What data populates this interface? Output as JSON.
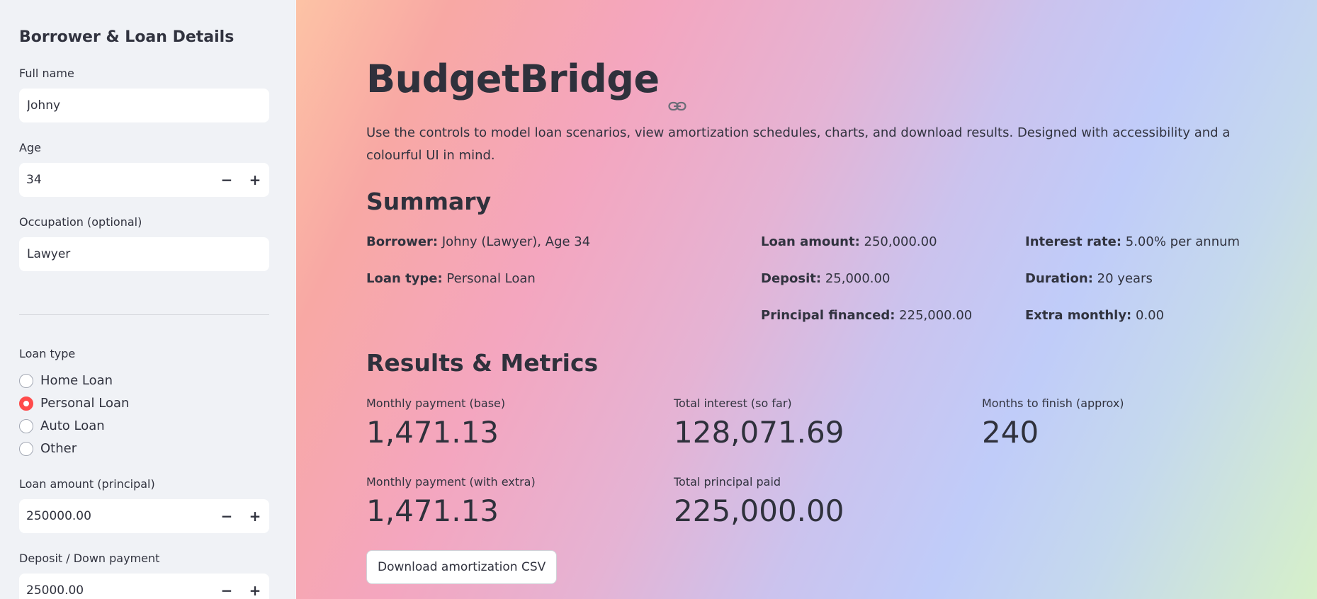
{
  "sidebar": {
    "title": "Borrower & Loan Details",
    "full_name": {
      "label": "Full name",
      "value": "Johny"
    },
    "age": {
      "label": "Age",
      "value": "34",
      "minus": "−",
      "plus": "+"
    },
    "occupation": {
      "label": "Occupation (optional)",
      "value": "Lawyer"
    },
    "loan_type": {
      "label": "Loan type",
      "options": [
        "Home Loan",
        "Personal Loan",
        "Auto Loan",
        "Other"
      ],
      "selected": "Personal Loan"
    },
    "loan_amount": {
      "label": "Loan amount (principal)",
      "value": "250000.00",
      "minus": "−",
      "plus": "+"
    },
    "deposit": {
      "label": "Deposit / Down payment",
      "value": "25000.00",
      "minus": "−",
      "plus": "+"
    }
  },
  "main": {
    "title": "BudgetBridge",
    "description": "Use the controls to model loan scenarios, view amortization schedules, charts, and download results. Designed with accessibility and a colourful UI in mind.",
    "summary": {
      "heading": "Summary",
      "borrower": {
        "key": "Borrower:",
        "value": " Johny (Lawyer), Age 34"
      },
      "loan_type": {
        "key": "Loan type:",
        "value": " Personal Loan"
      },
      "loan_amount": {
        "key": "Loan amount:",
        "value": " 250,000.00"
      },
      "deposit": {
        "key": "Deposit:",
        "value": " 25,000.00"
      },
      "principal_financed": {
        "key": "Principal financed:",
        "value": " 225,000.00"
      },
      "interest_rate": {
        "key": "Interest rate:",
        "value": " 5.00% per annum"
      },
      "duration": {
        "key": "Duration:",
        "value": " 20 years"
      },
      "extra_monthly": {
        "key": "Extra monthly:",
        "value": " 0.00"
      }
    },
    "results": {
      "heading": "Results & Metrics",
      "metrics": [
        {
          "label": "Monthly payment (base)",
          "value": "1,471.13"
        },
        {
          "label": "Total interest (so far)",
          "value": "128,071.69"
        },
        {
          "label": "Months to finish (approx)",
          "value": "240"
        },
        {
          "label": "Monthly payment (with extra)",
          "value": "1,471.13"
        },
        {
          "label": "Total principal paid",
          "value": "225,000.00"
        }
      ]
    },
    "download_button": "Download amortization CSV"
  },
  "colors": {
    "accent": "#ff4b4b",
    "text": "#31333f",
    "sidebar_bg": "#f0f2f6"
  },
  "icons": {
    "title_anchor": "link-icon"
  }
}
